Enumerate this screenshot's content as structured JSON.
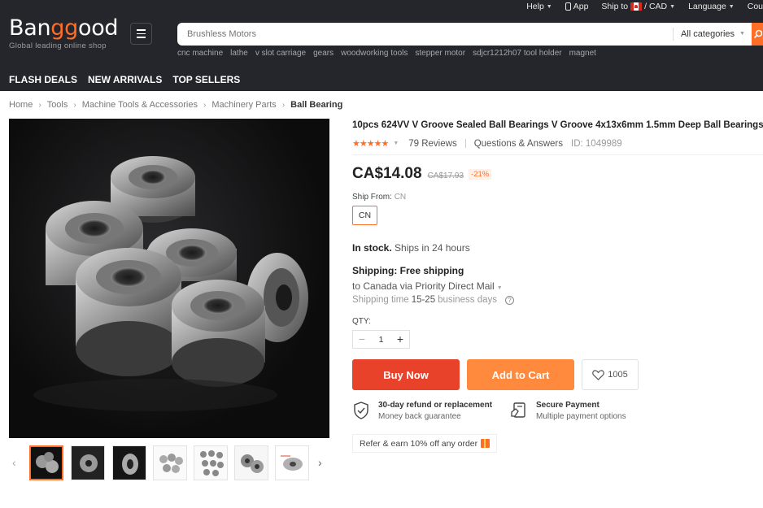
{
  "topbar": {
    "help": "Help",
    "app": "App",
    "ship_to": "Ship to",
    "currency": "/ CAD",
    "language": "Language",
    "country_partial": "Cou"
  },
  "logo": {
    "text_a": "Ban",
    "text_b": "gg",
    "text_c": "ood",
    "tagline": "Global leading online shop"
  },
  "search": {
    "placeholder": "Brushless Motors",
    "category": "All categories",
    "hot_keywords": [
      "cnc machine",
      "lathe",
      "v slot carriage",
      "gears",
      "woodworking tools",
      "stepper motor",
      "sdjcr1212h07 tool holder",
      "magnet"
    ]
  },
  "nav": {
    "flash_deals": "FLASH DEALS",
    "new_arrivals": "NEW ARRIVALS",
    "top_sellers": "TOP SELLERS"
  },
  "breadcrumb": [
    "Home",
    "Tools",
    "Machine Tools & Accessories",
    "Machinery Parts",
    "Ball Bearing"
  ],
  "product": {
    "title": "10pcs 624VV V Groove Sealed Ball Bearings V Groove 4x13x6mm 1.5mm Deep Ball Bearings",
    "stars": "★★★★★",
    "rating_value": 5,
    "reviews": "79 Reviews",
    "qa": "Questions & Answers",
    "id": "ID: 1049989",
    "price": "CA$14.08",
    "old_price": "CA$17.93",
    "discount": "-21%",
    "ship_from_label": "Ship From:",
    "ship_from_value": "CN",
    "ship_from_option": "CN",
    "stock_bold": "In stock.",
    "stock_rest": "Ships in 24 hours",
    "shipping_label": "Shipping:",
    "shipping_value": "Free shipping",
    "shipping_method": "to Canada via Priority Direct Mail",
    "shipping_time_label": "Shipping time",
    "shipping_days": "15-25",
    "shipping_days_unit": "business days",
    "qty_label": "QTY:",
    "qty_value": "1",
    "buy_now": "Buy Now",
    "add_to_cart": "Add to Cart",
    "wishlist_count": "1005",
    "guarantee1_title": "30-day refund or replacement",
    "guarantee1_sub": "Money back guarantee",
    "guarantee2_title": "Secure Payment",
    "guarantee2_sub": "Multiple payment options",
    "refer": "Refer & earn 10% off any order"
  },
  "colors": {
    "accent": "#ff6e26",
    "buy": "#e8432a",
    "cart": "#ff8a3d",
    "header_bg": "#25262b"
  }
}
